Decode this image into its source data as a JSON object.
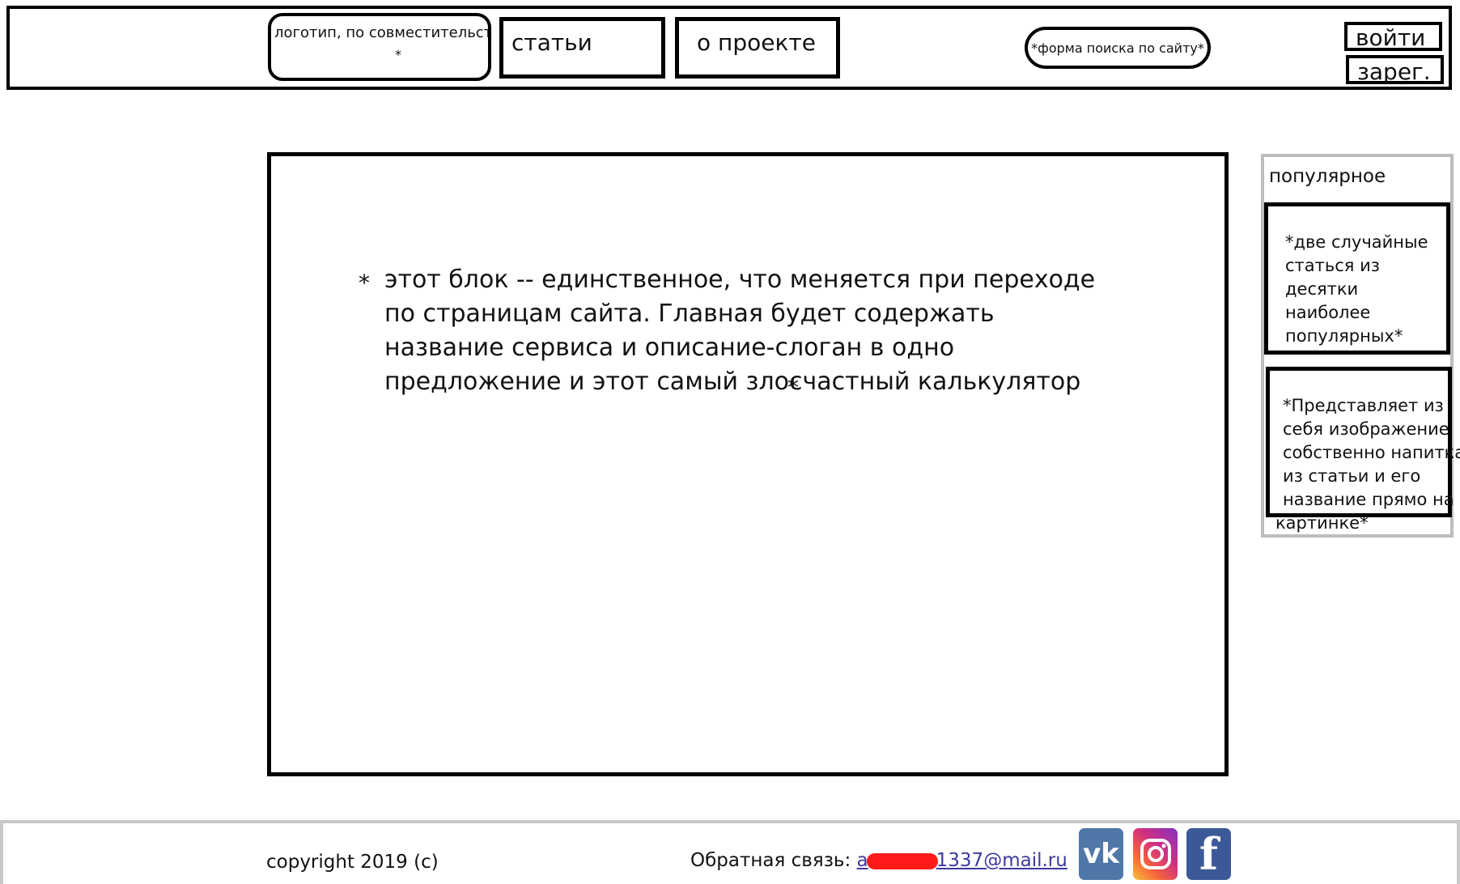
{
  "header": {
    "logo_text": "логотип, по совместительству ссылка на главную",
    "logo_cursor": "*",
    "nav": [
      {
        "label": "статьи"
      },
      {
        "label": "о проекте"
      }
    ],
    "search_placeholder": "*форма поиска по сайту*",
    "login_label": "войти",
    "register_label": "зарег."
  },
  "main": {
    "star_open": "*",
    "text": "этот блок -- единственное, что меняется при переходе по страницам сайта. Главная будет содержать название сервиса и описание-слоган в одно предложение и этот самый злосчастный калькулятор",
    "star_close": "*"
  },
  "sidebar": {
    "title": "популярное",
    "card1": "*две случайные статься из десятки наиболее популярных*",
    "card2_lines": [
      "*Представляет из",
      "себя изображение",
      "собственно напитка",
      "из статьи и его",
      "название прямо на",
      "картинке*"
    ]
  },
  "footer": {
    "copyright": "copyright 2019 (c)",
    "feedback_label": "Обратная связь: ",
    "email_prefix": "a",
    "email_suffix": "1337@mail.ru",
    "social": [
      "vk-icon",
      "instagram-icon",
      "facebook-icon"
    ],
    "vk_glyph": "vk",
    "fb_glyph": "f"
  }
}
